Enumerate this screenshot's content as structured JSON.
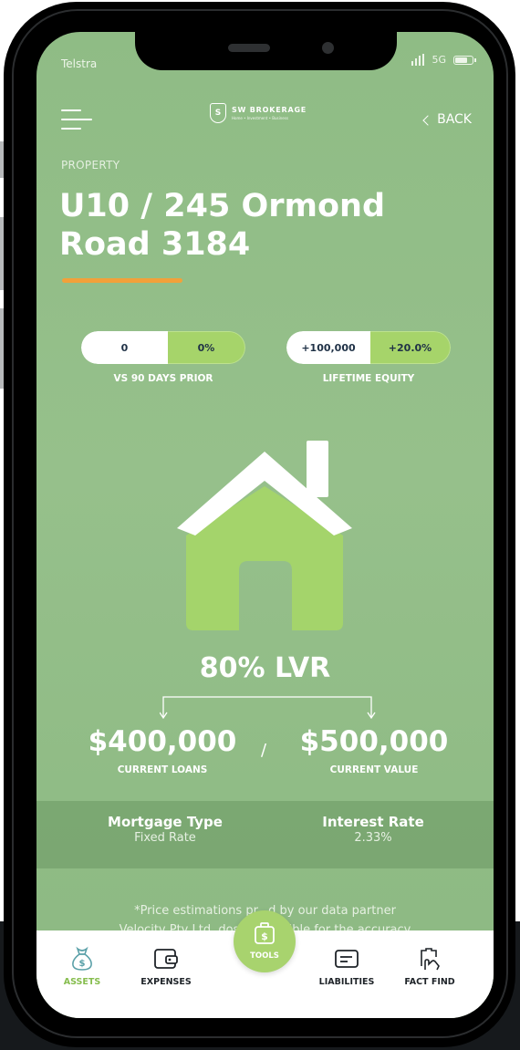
{
  "status_bar": {
    "carrier": "Telstra",
    "network": "5G"
  },
  "header": {
    "brand_name": "SW BROKERAGE",
    "brand_sub": "Home • Investment • Business",
    "back_label": "BACK"
  },
  "property": {
    "section_label": "PROPERTY",
    "title": "U10 / 245 Ormond Road 3184"
  },
  "stats": [
    {
      "left_value": "0",
      "right_value": "0%",
      "caption": "VS 90 DAYS PRIOR"
    },
    {
      "left_value": "+100,000",
      "right_value": "+20.0%",
      "caption": "LIFETIME EQUITY"
    }
  ],
  "lvr": {
    "label": "80% LVR",
    "fill_fraction": 0.8,
    "loans_value": "$400,000",
    "loans_label": "CURRENT LOANS",
    "separator": "/",
    "value_value": "$500,000",
    "value_label": "CURRENT VALUE"
  },
  "details": {
    "mortgage_type_label": "Mortgage Type",
    "mortgage_type_value": "Fixed Rate",
    "interest_rate_label": "Interest Rate",
    "interest_rate_value": "2.33%"
  },
  "disclaimer": {
    "line1": "*Price estimations pr...d by our data partner",
    "line2": "Velocity Pty Ltd. dosh is ...nsible for the accuracy"
  },
  "nav": {
    "assets": "ASSETS",
    "expenses": "EXPENSES",
    "tools": "TOOLS",
    "liabilities": "LIABILITIES",
    "fact_find": "FACT FIND"
  },
  "colors": {
    "background": "#93be88",
    "accent_green": "#a6d46a",
    "underline_orange": "#f2a13a",
    "pill_text": "#1f3146",
    "active_nav": "#86bd4e"
  }
}
